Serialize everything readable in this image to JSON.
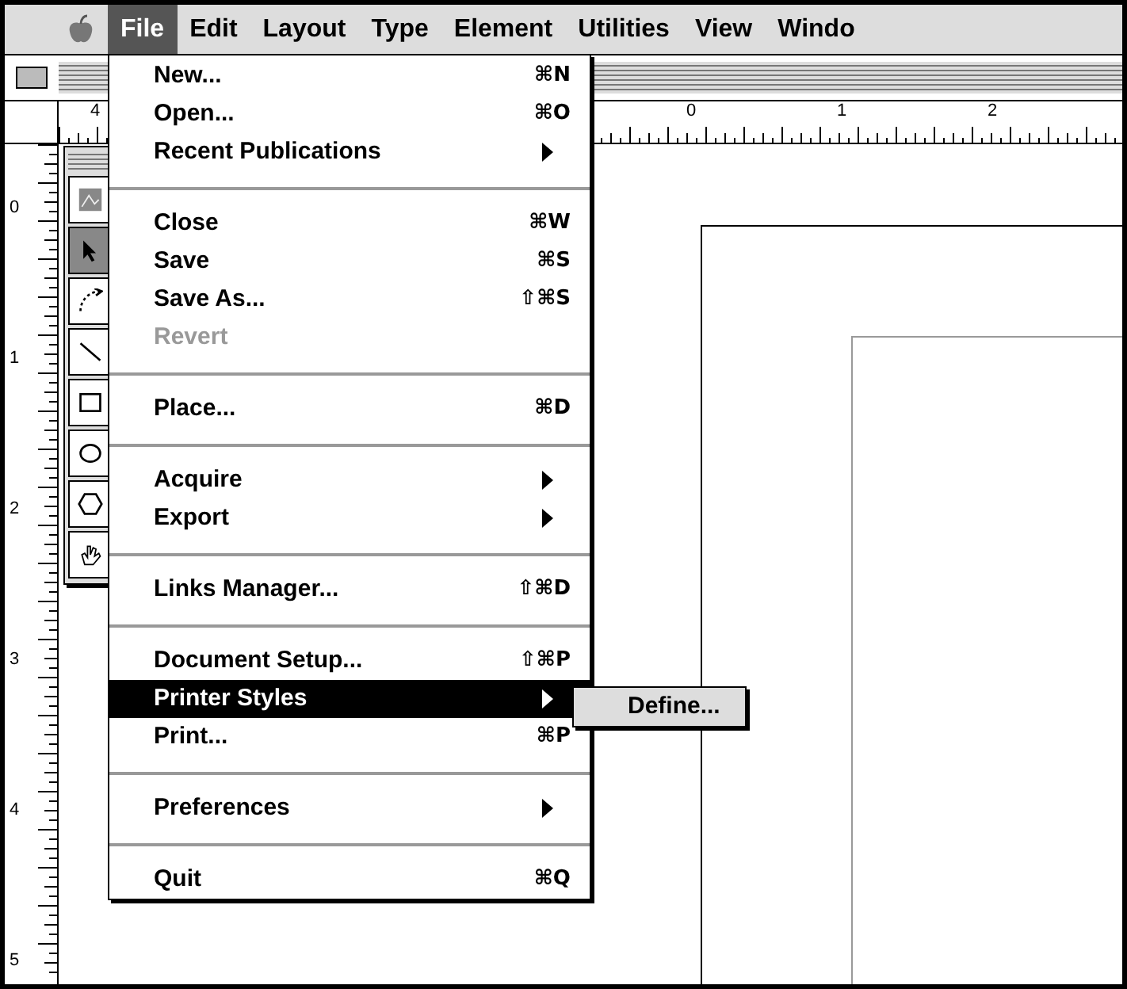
{
  "menubar": {
    "items": [
      {
        "label": "File",
        "selected": true
      },
      {
        "label": "Edit",
        "selected": false
      },
      {
        "label": "Layout",
        "selected": false
      },
      {
        "label": "Type",
        "selected": false
      },
      {
        "label": "Element",
        "selected": false
      },
      {
        "label": "Utilities",
        "selected": false
      },
      {
        "label": "View",
        "selected": false
      },
      {
        "label": "Windo",
        "selected": false
      }
    ]
  },
  "horizontal_ruler": {
    "labels": [
      "4",
      "0",
      "1",
      "2"
    ]
  },
  "vertical_ruler": {
    "labels": [
      "0",
      "1",
      "2",
      "3",
      "4",
      "5"
    ]
  },
  "toolbox": {
    "tools": [
      {
        "kind": "picture",
        "selected": false
      },
      {
        "kind": "pointer",
        "selected": true
      },
      {
        "kind": "rotate",
        "selected": false
      },
      {
        "kind": "line",
        "selected": false
      },
      {
        "kind": "rectangle",
        "selected": false
      },
      {
        "kind": "ellipse",
        "selected": false
      },
      {
        "kind": "polygon",
        "selected": false
      },
      {
        "kind": "hand",
        "selected": false
      }
    ]
  },
  "file_menu": {
    "items": [
      {
        "kind": "item",
        "label": "New...",
        "shortcut": "⌘N",
        "submenu": false,
        "disabled": false,
        "selected": false
      },
      {
        "kind": "item",
        "label": "Open...",
        "shortcut": "⌘O",
        "submenu": false,
        "disabled": false,
        "selected": false
      },
      {
        "kind": "item",
        "label": "Recent Publications",
        "submenu": true,
        "disabled": false,
        "selected": false
      },
      {
        "kind": "separator"
      },
      {
        "kind": "item",
        "label": "Close",
        "shortcut": "⌘W",
        "submenu": false,
        "disabled": false,
        "selected": false
      },
      {
        "kind": "item",
        "label": "Save",
        "shortcut": "⌘S",
        "submenu": false,
        "disabled": false,
        "selected": false
      },
      {
        "kind": "item",
        "label": "Save As...",
        "shortcut": "⇧⌘S",
        "submenu": false,
        "disabled": false,
        "selected": false
      },
      {
        "kind": "item",
        "label": "Revert",
        "submenu": false,
        "disabled": true,
        "selected": false
      },
      {
        "kind": "separator"
      },
      {
        "kind": "item",
        "label": "Place...",
        "shortcut": "⌘D",
        "submenu": false,
        "disabled": false,
        "selected": false
      },
      {
        "kind": "separator"
      },
      {
        "kind": "item",
        "label": "Acquire",
        "submenu": true,
        "disabled": false,
        "selected": false
      },
      {
        "kind": "item",
        "label": "Export",
        "submenu": true,
        "disabled": false,
        "selected": false
      },
      {
        "kind": "separator"
      },
      {
        "kind": "item",
        "label": "Links Manager...",
        "shortcut": "⇧⌘D",
        "submenu": false,
        "disabled": false,
        "selected": false
      },
      {
        "kind": "separator"
      },
      {
        "kind": "item",
        "label": "Document Setup...",
        "shortcut": "⇧⌘P",
        "submenu": false,
        "disabled": false,
        "selected": false
      },
      {
        "kind": "item",
        "label": "Printer Styles",
        "submenu": true,
        "disabled": false,
        "selected": true,
        "children": [
          {
            "label": "Define..."
          }
        ]
      },
      {
        "kind": "item",
        "label": "Print...",
        "shortcut": "⌘P",
        "submenu": false,
        "disabled": false,
        "selected": false
      },
      {
        "kind": "separator"
      },
      {
        "kind": "item",
        "label": "Preferences",
        "submenu": true,
        "disabled": false,
        "selected": false
      },
      {
        "kind": "separator"
      },
      {
        "kind": "item",
        "label": "Quit",
        "shortcut": "⌘Q",
        "submenu": false,
        "disabled": false,
        "selected": false
      }
    ]
  }
}
